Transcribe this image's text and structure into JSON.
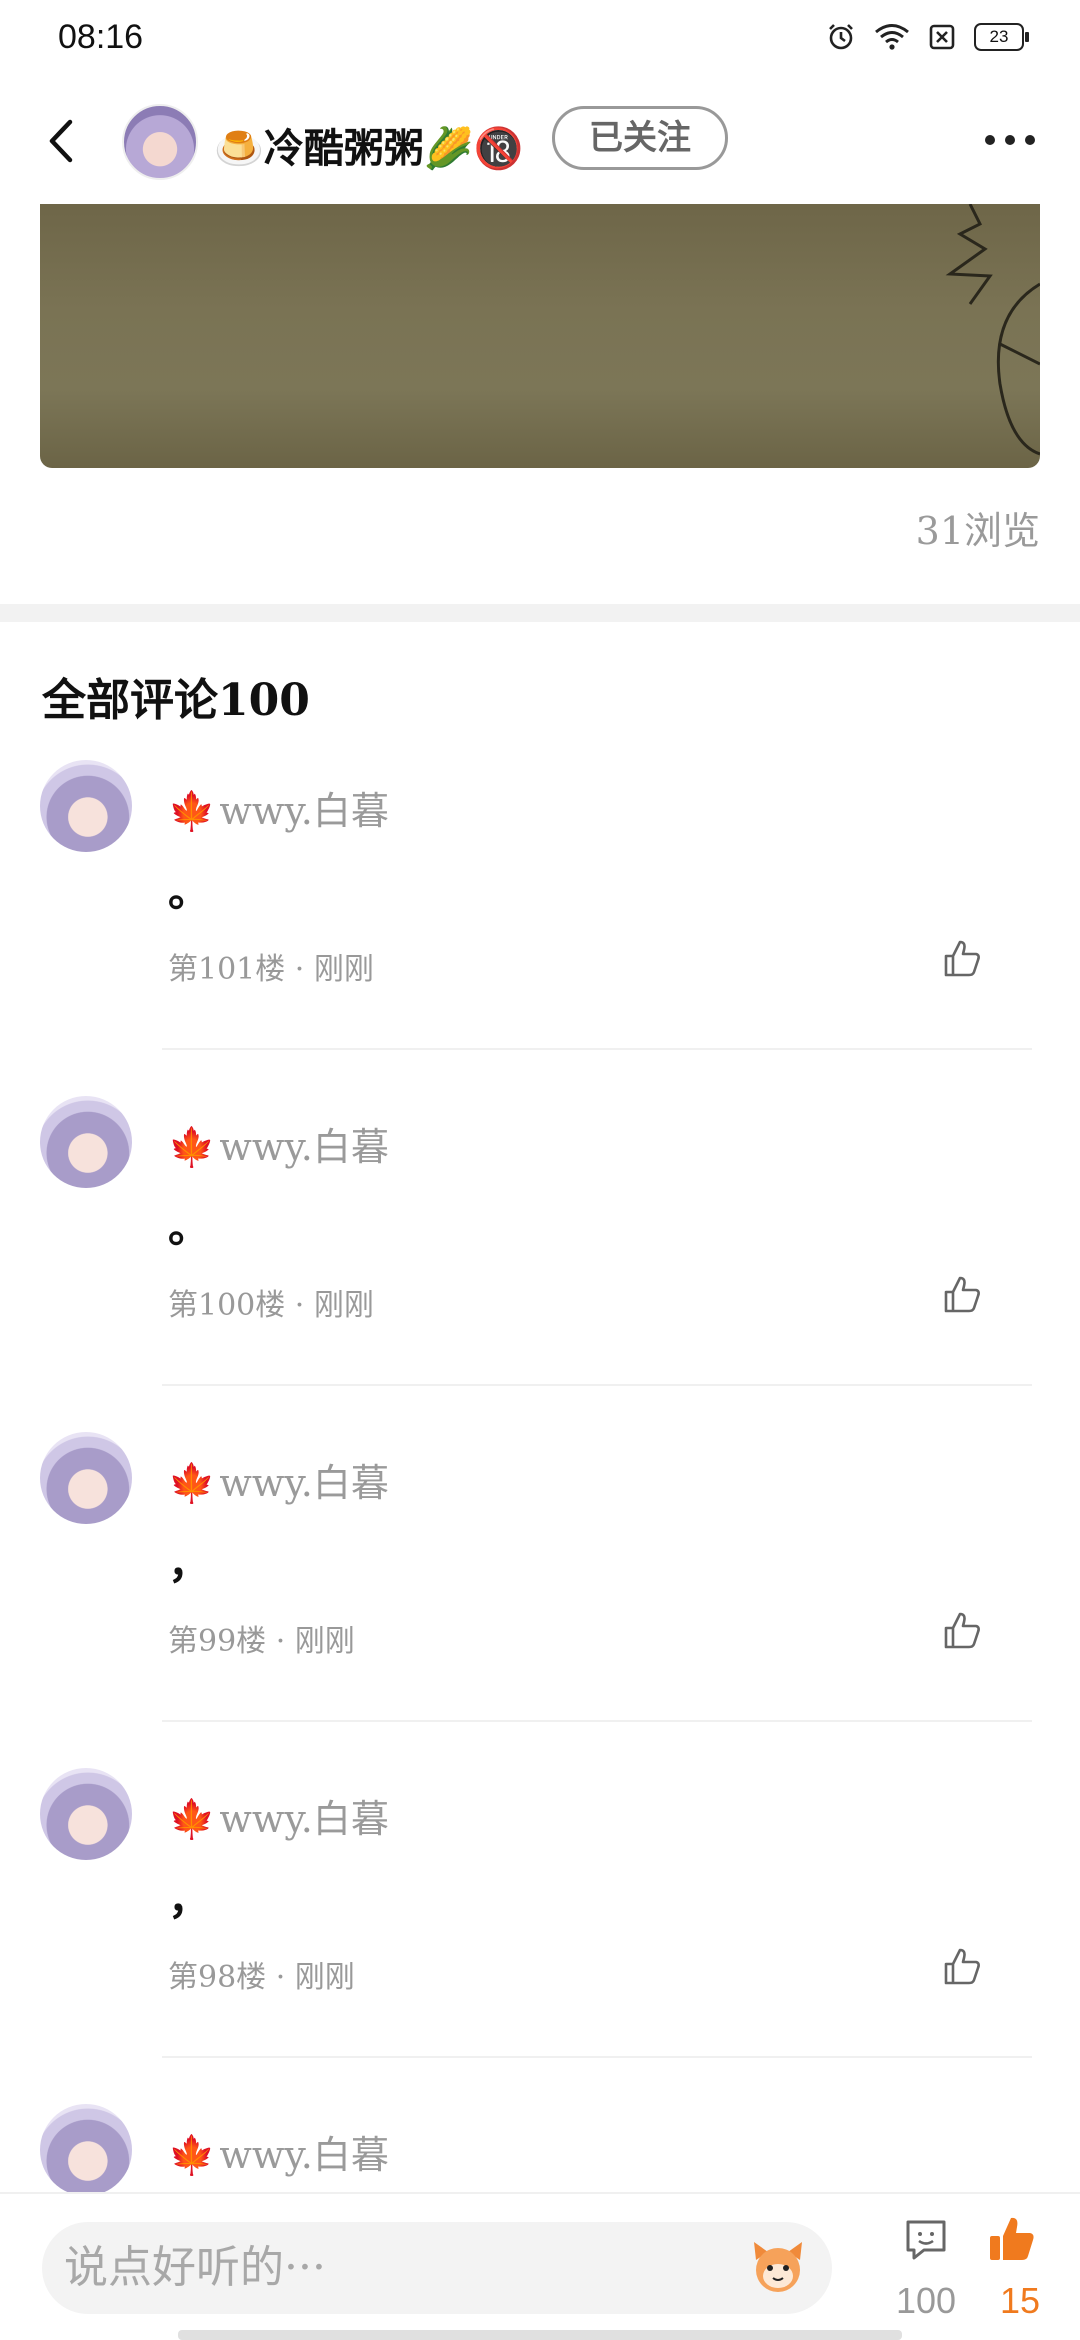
{
  "status_bar": {
    "time": "08:16",
    "battery": "23",
    "icons": [
      "alarm-icon",
      "wifi-icon",
      "sim-off-icon",
      "battery-icon"
    ]
  },
  "header": {
    "author_name": "🍮冷酷粥粥🌽🔞",
    "follow_label": "已关注"
  },
  "post": {
    "view_count": "31浏览"
  },
  "comments_section": {
    "title": "全部评论100",
    "items": [
      {
        "user": "wwy.白暮",
        "text": "。",
        "meta": "第101楼 · 刚刚"
      },
      {
        "user": "wwy.白暮",
        "text": "。",
        "meta": "第100楼 · 刚刚"
      },
      {
        "user": "wwy.白暮",
        "text": "，",
        "meta": "第99楼 · 刚刚"
      },
      {
        "user": "wwy.白暮",
        "text": "，",
        "meta": "第98楼 · 刚刚"
      },
      {
        "user": "wwy.白暮",
        "text": "",
        "meta": ""
      }
    ]
  },
  "bottom_bar": {
    "input_placeholder": "说点好听的···",
    "comment_count": "100",
    "like_count": "15"
  },
  "colors": {
    "accent": "#f07a1e",
    "muted_text": "#9a9a9a",
    "divider": "#f2f2f2"
  }
}
